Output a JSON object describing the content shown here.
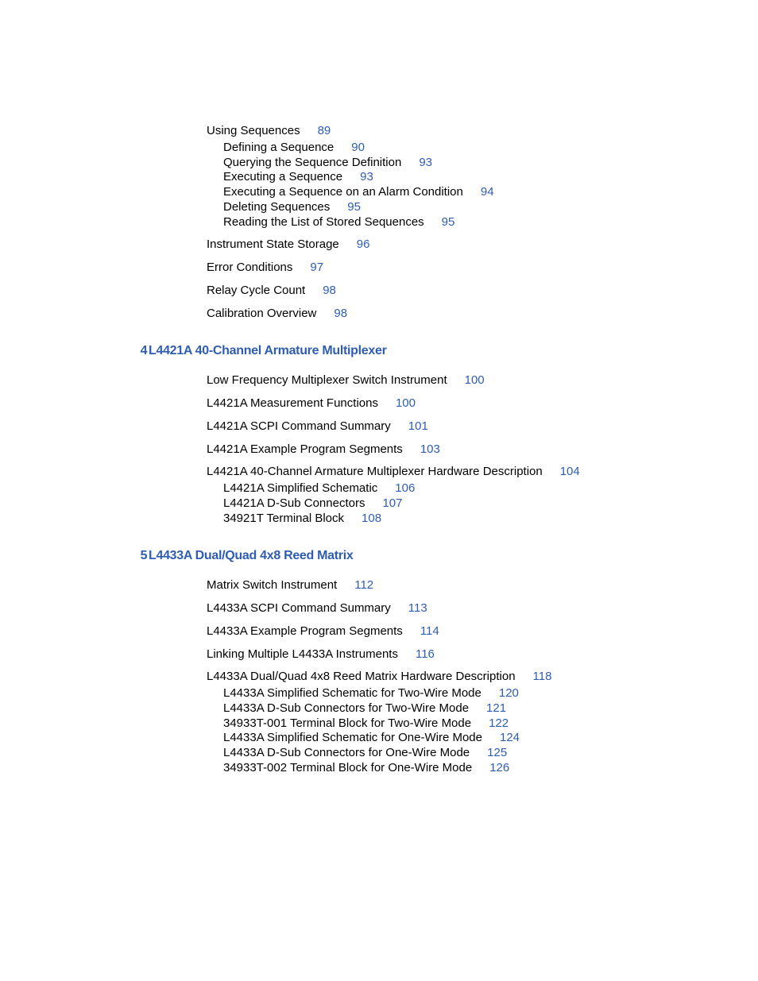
{
  "chapter3_continued": {
    "entries": [
      {
        "level": 1,
        "text": "Using Sequences",
        "page": "89"
      },
      {
        "level": 2,
        "text": "Defining a Sequence",
        "page": "90"
      },
      {
        "level": 2,
        "text": "Querying the Sequence Definition",
        "page": "93"
      },
      {
        "level": 2,
        "text": "Executing a Sequence",
        "page": "93"
      },
      {
        "level": 2,
        "text": "Executing a Sequence on an Alarm Condition",
        "page": "94"
      },
      {
        "level": 2,
        "text": "Deleting Sequences",
        "page": "95"
      },
      {
        "level": 2,
        "text": "Reading the List of Stored Sequences",
        "page": "95"
      },
      {
        "level": 1,
        "text": "Instrument State Storage",
        "page": "96"
      },
      {
        "level": 1,
        "text": "Error Conditions",
        "page": "97"
      },
      {
        "level": 1,
        "text": "Relay Cycle Count",
        "page": "98"
      },
      {
        "level": 1,
        "text": "Calibration Overview",
        "page": "98"
      }
    ]
  },
  "chapter4": {
    "number": "4",
    "title": "L4421A 40-Channel Armature Multiplexer",
    "entries": [
      {
        "level": 1,
        "text": "Low Frequency Multiplexer Switch Instrument",
        "page": "100"
      },
      {
        "level": 1,
        "text": "L4421A Measurement Functions",
        "page": "100"
      },
      {
        "level": 1,
        "text": "L4421A SCPI Command Summary",
        "page": "101"
      },
      {
        "level": 1,
        "text": "L4421A Example Program Segments",
        "page": "103"
      },
      {
        "level": 1,
        "text": "L4421A 40-Channel Armature Multiplexer Hardware Description",
        "page": "104"
      },
      {
        "level": 2,
        "text": "L4421A Simplified Schematic",
        "page": "106"
      },
      {
        "level": 2,
        "text": "L4421A D-Sub Connectors",
        "page": "107"
      },
      {
        "level": 2,
        "text": "34921T Terminal Block",
        "page": "108"
      }
    ]
  },
  "chapter5": {
    "number": "5",
    "title": "L4433A Dual/Quad 4x8 Reed Matrix",
    "entries": [
      {
        "level": 1,
        "text": "Matrix Switch Instrument",
        "page": "112"
      },
      {
        "level": 1,
        "text": "L4433A SCPI Command Summary",
        "page": "113"
      },
      {
        "level": 1,
        "text": "L4433A Example Program Segments",
        "page": "114"
      },
      {
        "level": 1,
        "text": "Linking Multiple L4433A Instruments",
        "page": "116"
      },
      {
        "level": 1,
        "text": "L4433A Dual/Quad 4x8 Reed Matrix Hardware Description",
        "page": "118"
      },
      {
        "level": 2,
        "text": "L4433A Simplified Schematic for Two-Wire Mode",
        "page": "120"
      },
      {
        "level": 2,
        "text": "L4433A D-Sub Connectors for Two-Wire Mode",
        "page": "121"
      },
      {
        "level": 2,
        "text": "34933T-001 Terminal Block for Two-Wire Mode",
        "page": "122"
      },
      {
        "level": 2,
        "text": "L4433A Simplified Schematic for One-Wire Mode",
        "page": "124"
      },
      {
        "level": 2,
        "text": "L4433A D-Sub Connectors for One-Wire Mode",
        "page": "125"
      },
      {
        "level": 2,
        "text": "34933T-002 Terminal Block for One-Wire Mode",
        "page": "126"
      }
    ]
  }
}
